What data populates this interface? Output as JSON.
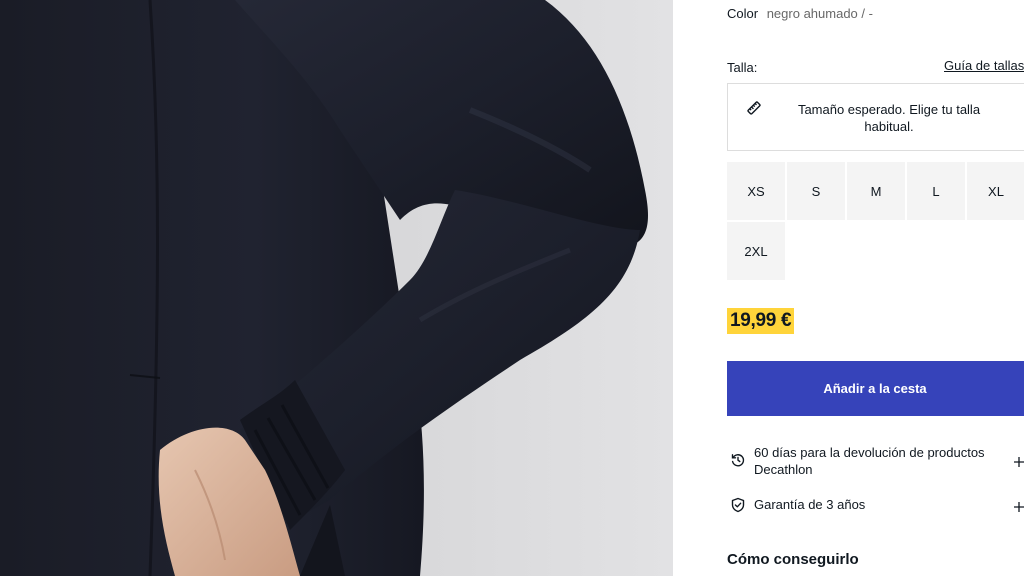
{
  "product": {
    "color_label": "Color",
    "color_value": "negro ahumado / -",
    "size_label": "Talla:",
    "size_guide_link": "Guía de tallas",
    "fit_message": "Tamaño esperado. Elige tu talla habitual.",
    "sizes": [
      "XS",
      "S",
      "M",
      "L",
      "XL",
      "2XL"
    ],
    "price": "19,99 €",
    "add_to_cart": "Añadir a la cesta"
  },
  "benefits": [
    {
      "icon": "return-arrow-icon",
      "text": "60 días para la devolución de productos Decathlon"
    },
    {
      "icon": "shield-check-icon",
      "text": "Garantía de 3 años"
    }
  ],
  "section": {
    "title": "Cómo conseguirlo"
  },
  "colors": {
    "primary": "#3643ba",
    "price_highlight": "#ffd43a",
    "size_tile_bg": "#f4f4f4",
    "text": "#101820"
  }
}
